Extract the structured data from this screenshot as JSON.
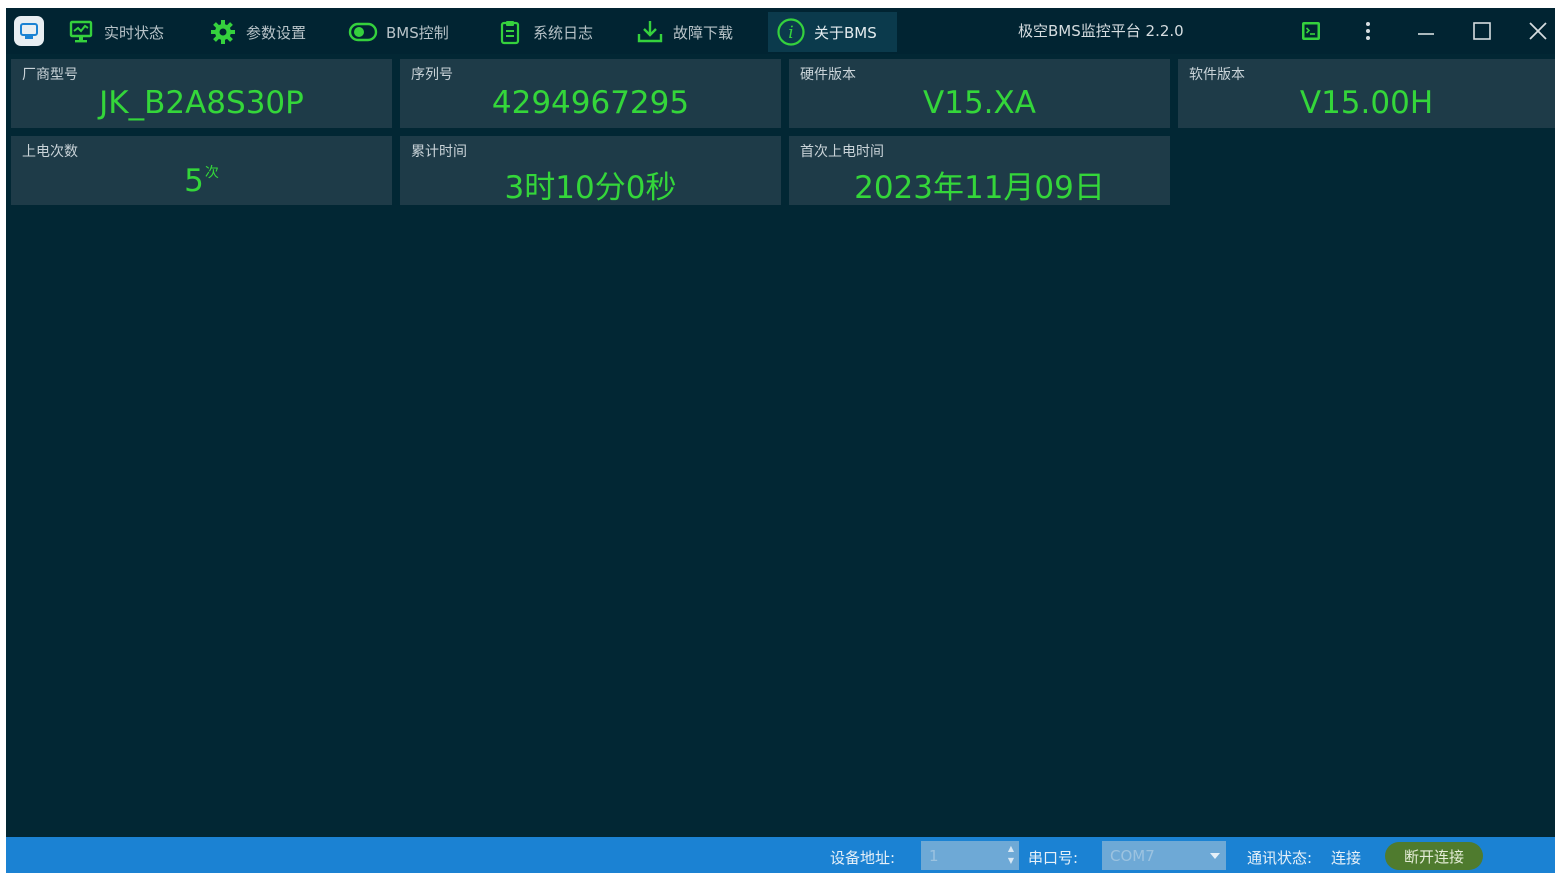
{
  "toolbar": {
    "menu": [
      {
        "label": "实时状态",
        "icon": "monitor-icon"
      },
      {
        "label": "参数设置",
        "icon": "gear-icon"
      },
      {
        "label": "BMS控制",
        "icon": "toggle-icon"
      },
      {
        "label": "系统日志",
        "icon": "clipboard-icon"
      },
      {
        "label": "故障下载",
        "icon": "download-icon"
      },
      {
        "label": "关于BMS",
        "icon": "info-icon"
      }
    ],
    "active_index": 5,
    "app_title": "极空BMS监控平台 2.2.0"
  },
  "cards": [
    {
      "label": "厂商型号",
      "value": "JK_B2A8S30P"
    },
    {
      "label": "序列号",
      "value": "4294967295"
    },
    {
      "label": "硬件版本",
      "value": "V15.XA"
    },
    {
      "label": "软件版本",
      "value": "V15.00H"
    },
    {
      "label": "上电次数",
      "value": "5",
      "unit": "次"
    },
    {
      "label": "累计时间",
      "value": "3时10分0秒"
    },
    {
      "label": "首次上电时间",
      "value": "2023年11月09日"
    }
  ],
  "statusbar": {
    "device_address_label": "设备地址:",
    "device_address_value": "1",
    "port_label": "串口号:",
    "port_value": "COM7",
    "comm_status_label": "通讯状态:",
    "comm_status_value": "连接",
    "disconnect_label": "断开连接"
  },
  "colors": {
    "background": "#022734",
    "card": "#1e3b48",
    "value_green": "#34d63a",
    "icon_green": "#35d13d",
    "statusbar_blue": "#1b82d3",
    "button_green": "#4f7b2e"
  }
}
